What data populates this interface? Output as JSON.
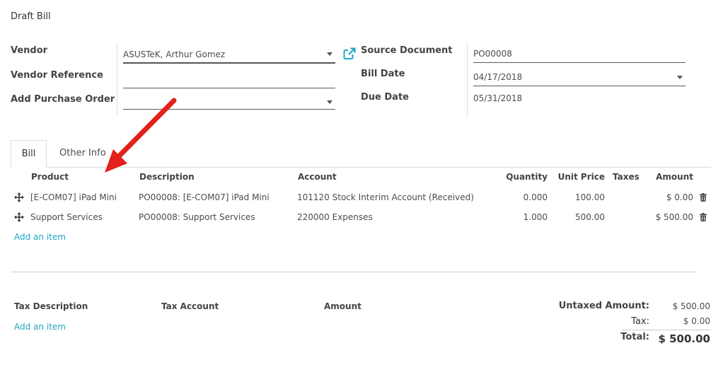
{
  "title": "Draft Bill",
  "form": {
    "vendor_label": "Vendor",
    "vendor_value": "ASUSTeK, Arthur Gomez",
    "vendor_ref_label": "Vendor Reference",
    "vendor_ref_value": "",
    "add_po_label": "Add Purchase Order",
    "add_po_value": "",
    "source_doc_label": "Source Document",
    "source_doc_value": "PO00008",
    "bill_date_label": "Bill Date",
    "bill_date_value": "04/17/2018",
    "due_date_label": "Due Date",
    "due_date_value": "05/31/2018"
  },
  "tabs": [
    {
      "label": "Bill",
      "active": true
    },
    {
      "label": "Other Info",
      "active": false
    }
  ],
  "lines": {
    "headers": {
      "product": "Product",
      "description": "Description",
      "account": "Account",
      "quantity": "Quantity",
      "unit_price": "Unit Price",
      "taxes": "Taxes",
      "amount": "Amount"
    },
    "rows": [
      {
        "product": "[E-COM07] iPad Mini",
        "description": "PO00008: [E-COM07] iPad Mini",
        "account": "101120 Stock Interim Account (Received)",
        "quantity": "0.000",
        "unit_price": "100.00",
        "taxes": "",
        "amount": "$ 0.00"
      },
      {
        "product": "Support Services",
        "description": "PO00008: Support Services",
        "account": "220000 Expenses",
        "quantity": "1.000",
        "unit_price": "500.00",
        "taxes": "",
        "amount": "$ 500.00"
      }
    ],
    "add_item": "Add an item"
  },
  "tax": {
    "headers": {
      "description": "Tax Description",
      "account": "Tax Account",
      "amount": "Amount"
    },
    "add_item": "Add an item"
  },
  "totals": {
    "untaxed_label": "Untaxed Amount:",
    "untaxed_value": "$ 500.00",
    "tax_label": "Tax:",
    "tax_value": "$ 0.00",
    "total_label": "Total:",
    "total_value": "$ 500.00"
  },
  "colors": {
    "link": "#21a5c8",
    "annotation_arrow": "#e3201b",
    "external_link_icon": "#21a5c8"
  }
}
